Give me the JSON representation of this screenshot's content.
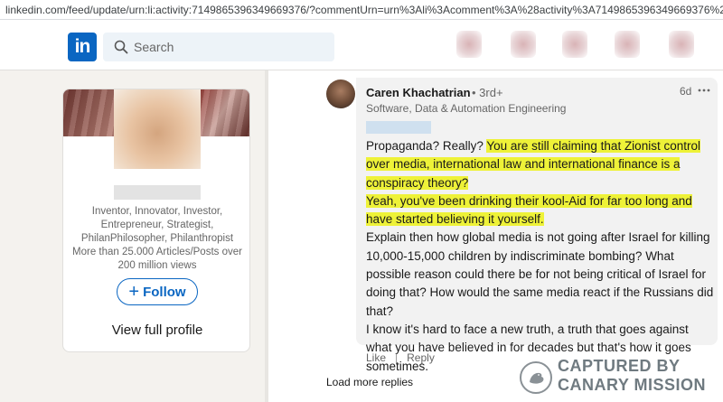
{
  "browser": {
    "url": "linkedin.com/feed/update/urn:li:activity:7149865396349669376/?commentUrn=urn%3Ali%3Acomment%3A%28activity%3A7149865396349669376%2C7150020246681063424%"
  },
  "nav": {
    "logo_text": "in",
    "search_placeholder": "Search"
  },
  "profile_card": {
    "headline": "Inventor, Innovator, Investor,\nEntrepreneur, Strategist,\nPhilanPhilosopher, Philanthropist\nMore than 25.000 Articles/Posts over\n200 million views",
    "follow_plus": "+",
    "follow_label": "Follow",
    "view_profile_label": "View full profile"
  },
  "comment": {
    "author": "Caren Khachatrian",
    "degree": "• 3rd+",
    "time": "6d",
    "author_subtitle": "Software, Data & Automation Engineering",
    "text_intro": "Propaganda? Really? ",
    "text_highlight_1": "You are still claiming that Zionist control over media, international law and international finance is a conspiracy theory?",
    "text_highlight_2": "Yeah, you've been drinking their kool-Aid for far too long and have started believing it yourself.",
    "text_rest_1": "Explain then how global media is not going after Israel for killing 10,000-15,000 children by indiscriminate bombing? What possible reason could there be for not being critical of Israel for doing that? How would the same media react if the Russians did that?",
    "text_rest_2": "I know it's hard to face a new truth, a truth that goes against what you have believed in for decades but that's how it goes sometimes.",
    "like_label": "Like",
    "separator": "|",
    "reply_label": "Reply",
    "load_more_label": "Load more replies"
  },
  "watermark": {
    "text": "CAPTURED BY\nCANARY MISSION"
  },
  "colors": {
    "brand_blue": "#0a66c2",
    "highlight": "#eef238"
  }
}
